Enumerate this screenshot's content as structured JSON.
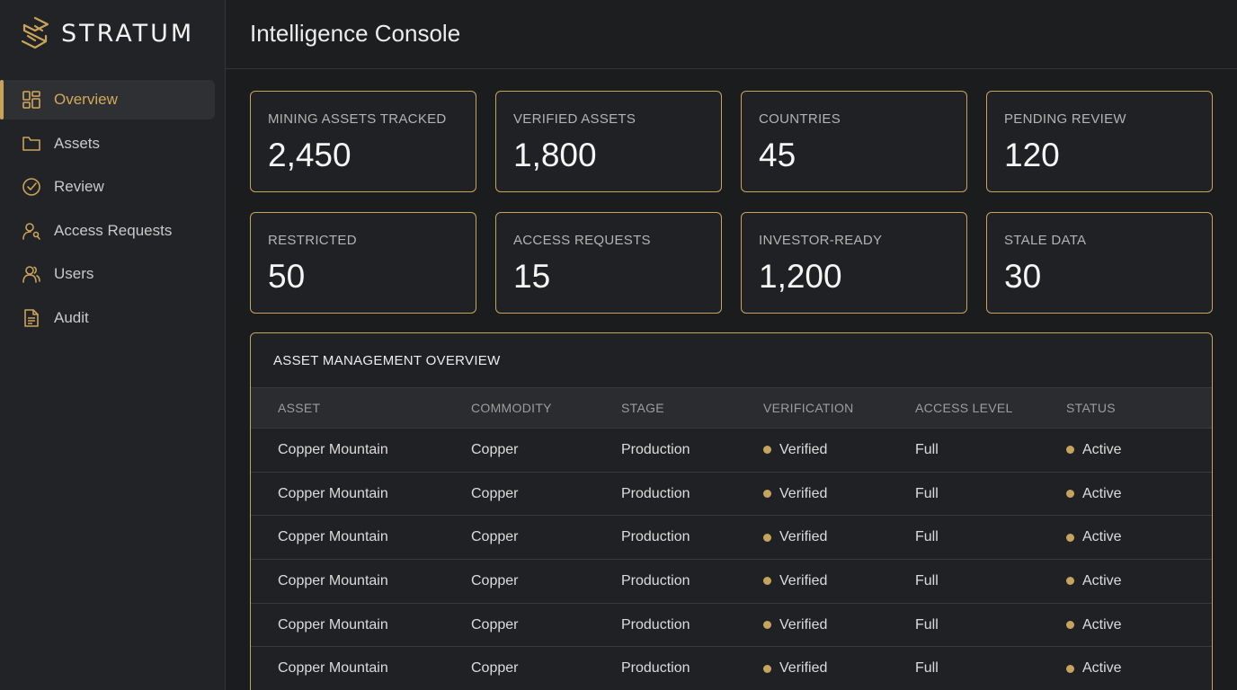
{
  "brand": {
    "name": "STRATUM"
  },
  "nav": [
    {
      "label": "Overview",
      "icon": "dashboard-grid-icon",
      "active": true
    },
    {
      "label": "Assets",
      "icon": "folder-icon",
      "active": false
    },
    {
      "label": "Review",
      "icon": "check-circle-icon",
      "active": false
    },
    {
      "label": "Access Requests",
      "icon": "user-key-icon",
      "active": false
    },
    {
      "label": "Users",
      "icon": "users-icon",
      "active": false
    },
    {
      "label": "Audit",
      "icon": "document-icon",
      "active": false
    }
  ],
  "header": {
    "title": "Intelligence Console"
  },
  "stats": [
    {
      "label": "MINING ASSETS TRACKED",
      "value": "2,450"
    },
    {
      "label": "VERIFIED ASSETS",
      "value": "1,800"
    },
    {
      "label": "COUNTRIES",
      "value": "45"
    },
    {
      "label": "PENDING REVIEW",
      "value": "120"
    },
    {
      "label": "RESTRICTED",
      "value": "50"
    },
    {
      "label": "ACCESS REQUESTS",
      "value": "15"
    },
    {
      "label": "INVESTOR-READY",
      "value": "1,200"
    },
    {
      "label": "STALE DATA",
      "value": "30"
    }
  ],
  "table": {
    "title": "ASSET MANAGEMENT OVERVIEW",
    "columns": [
      "ASSET",
      "COMMODITY",
      "STAGE",
      "VERIFICATION",
      "ACCESS LEVEL",
      "STATUS"
    ],
    "rows": [
      [
        "Copper Mountain",
        "Copper",
        "Production",
        "Verified",
        "Full",
        "Active"
      ],
      [
        "Copper Mountain",
        "Copper",
        "Production",
        "Verified",
        "Full",
        "Active"
      ],
      [
        "Copper Mountain",
        "Copper",
        "Production",
        "Verified",
        "Full",
        "Active"
      ],
      [
        "Copper Mountain",
        "Copper",
        "Production",
        "Verified",
        "Full",
        "Active"
      ],
      [
        "Copper Mountain",
        "Copper",
        "Production",
        "Verified",
        "Full",
        "Active"
      ],
      [
        "Copper Mountain",
        "Copper",
        "Production",
        "Verified",
        "Full",
        "Active"
      ]
    ]
  },
  "colors": {
    "accent": "#c7a45e",
    "background": "#1b1c1e",
    "sidebar": "#222326"
  }
}
